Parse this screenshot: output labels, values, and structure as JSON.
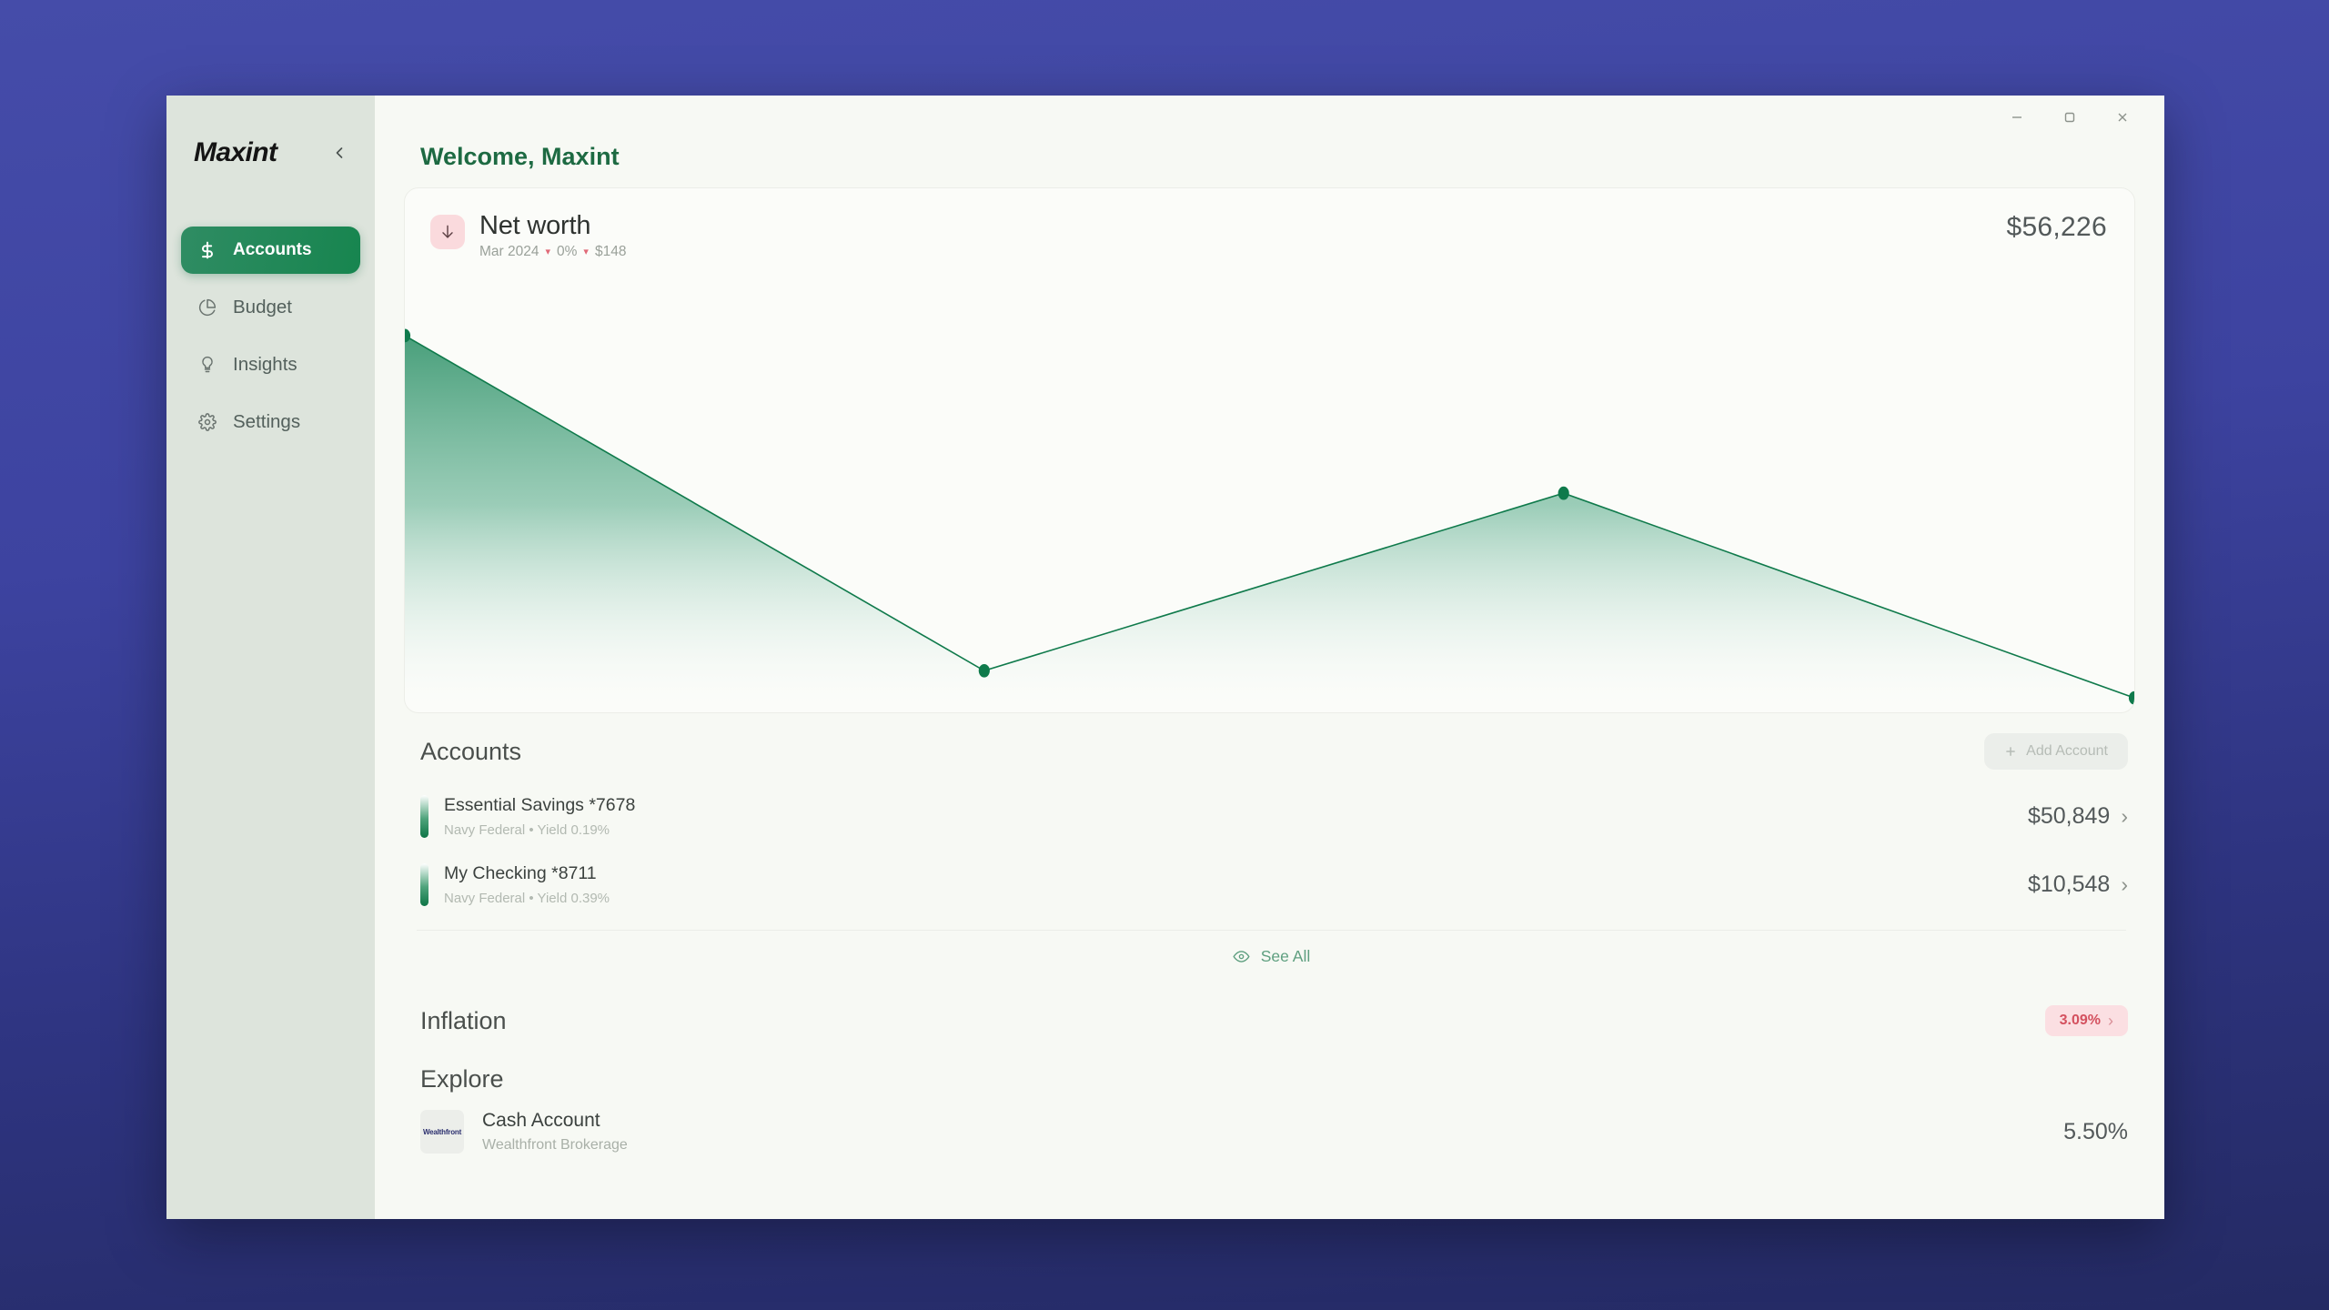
{
  "window": {
    "controls": [
      {
        "name": "minimize",
        "glyph": "–"
      },
      {
        "name": "maximize",
        "glyph": "▢"
      },
      {
        "name": "close",
        "glyph": "✕"
      }
    ]
  },
  "sidebar": {
    "brand": "Maxint",
    "collapse_icon": "chevron-left-icon",
    "items": [
      {
        "label": "Accounts",
        "icon": "dollar-icon",
        "active": true
      },
      {
        "label": "Budget",
        "icon": "pie-chart-icon",
        "active": false
      },
      {
        "label": "Insights",
        "icon": "lightbulb-icon",
        "active": false
      },
      {
        "label": "Settings",
        "icon": "gear-icon",
        "active": false
      }
    ]
  },
  "header": {
    "welcome": "Welcome, Maxint"
  },
  "net_worth": {
    "icon": "arrow-down-icon",
    "title": "Net worth",
    "period": "Mar 2024",
    "change_percent": "0%",
    "change_amount": "$148",
    "value": "$56,226",
    "accent": "#17854f",
    "badge_bg": "#fadadd"
  },
  "chart_data": {
    "type": "area",
    "title": "Net worth",
    "x": [
      0,
      1,
      2,
      3
    ],
    "categories": [
      "",
      "",
      "",
      ""
    ],
    "values": [
      56226,
      8400,
      33000,
      5000
    ],
    "series": [
      {
        "name": "Net worth",
        "values": [
          56226,
          8400,
          33000,
          5000
        ]
      }
    ],
    "points_norm": [
      {
        "x": 0.0,
        "y": 1.0
      },
      {
        "x": 0.335,
        "y": 0.075
      },
      {
        "x": 0.67,
        "y": 0.565
      },
      {
        "x": 1.0,
        "y": 0.0
      }
    ],
    "xlabel": "",
    "ylabel": "",
    "grid": false,
    "legend": "none",
    "line_color": "#0f7a4b",
    "fill_top": "#4aa37c",
    "fill_bottom": "#ffffff"
  },
  "accounts_section": {
    "title": "Accounts",
    "add_button": {
      "label": "Add Account",
      "icon": "plus-icon"
    },
    "rows": [
      {
        "name": "Essential Savings *7678",
        "meta": "Navy Federal • Yield 0.19%",
        "amount": "$50,849",
        "chevron": "chevron-right-icon"
      },
      {
        "name": "My Checking *8711",
        "meta": "Navy Federal • Yield 0.39%",
        "amount": "$10,548",
        "chevron": "chevron-right-icon"
      }
    ],
    "see_all": {
      "label": "See All",
      "icon": "eye-icon"
    }
  },
  "inflation": {
    "title": "Inflation",
    "badge_value": "3.09%",
    "badge_chevron": "chevron-right-icon",
    "badge_bg": "#fbdfe2",
    "badge_color": "#d4515f"
  },
  "explore": {
    "title": "Explore",
    "rows": [
      {
        "logo_text": "Wealthfront",
        "name": "Cash Account",
        "sub": "Wealthfront Brokerage",
        "rate": "5.50%"
      }
    ]
  }
}
